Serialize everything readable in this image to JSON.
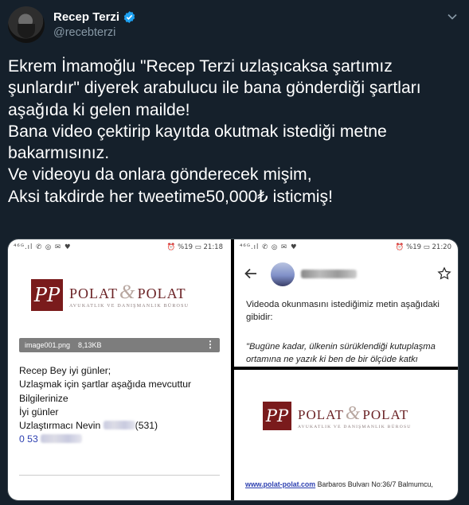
{
  "tweet": {
    "author_name": "Recep Terzi",
    "author_handle": "@recebterzi",
    "text_lines": [
      "Ekrem İmamoğlu \"Recep Terzi uzlaşıcaksa şartımız",
      "şunlardır\" diyerek arabulucu ile bana gönderdiği şartları",
      "aşağıda ki gelen mailde!",
      "Bana video çektirip kayıtda okutmak istediği metne",
      "bakarmısınız.",
      "Ve videoyu da onlara gönderecek mişim,",
      "Aksi takdirde her tweetime50,000₺ isticmiş!"
    ]
  },
  "left_screenshot": {
    "status_left": "⁴⁶ᴳ.ıl ✆ ◎ ✉ ♥",
    "status_right": "⏰ %19 ▭ 21:18",
    "logo_left": "POLAT",
    "logo_amp": "&",
    "logo_right": "POLAT",
    "logo_sub": "AVUKATLIK VE DANIŞMANLIK BÜROSU",
    "attachment_name": "image001.png",
    "attachment_size": "8,13KB",
    "attachment_menu": "⋮",
    "body_lines": [
      "Recep Bey iyi günler;",
      "Uzlaşmak için şartlar aşağıda mevcuttur",
      "Bilgilerinize",
      "İyi günler"
    ],
    "mediator_prefix": "Uzlaştırmacı Nevin",
    "mediator_suffix": "(531)",
    "phone_prefix": "0 53"
  },
  "right_top_screenshot": {
    "status_left": "⁴⁶ᴳ.ıl ✆ ◎ ✉ ♥",
    "status_right": "⏰ %19 ▭ 21:20",
    "intro": "Videoda okunmasını istediğimiz metin aşağıdaki gibidir:",
    "quote_line1": "\"Bugüne kadar, ülkenin sürüklendiği kutuplaşma",
    "quote_line2": "ortamına ne yazık ki ben de bir ölçüde katkı"
  },
  "right_bottom_screenshot": {
    "logo_left": "POLAT",
    "logo_amp": "&",
    "logo_right": "POLAT",
    "logo_sub": "AVUKATLIK VE DANIŞMANLIK BÜROSU",
    "website": "www.polat-polat.com",
    "address": "Barbaros Bulvarı No:36/7 Balmumcu,"
  },
  "colors": {
    "background": "#15202b",
    "brand_maroon": "#7a1b1c",
    "link_blue": "#2c3fb0",
    "verified_blue": "#1da1f2"
  }
}
